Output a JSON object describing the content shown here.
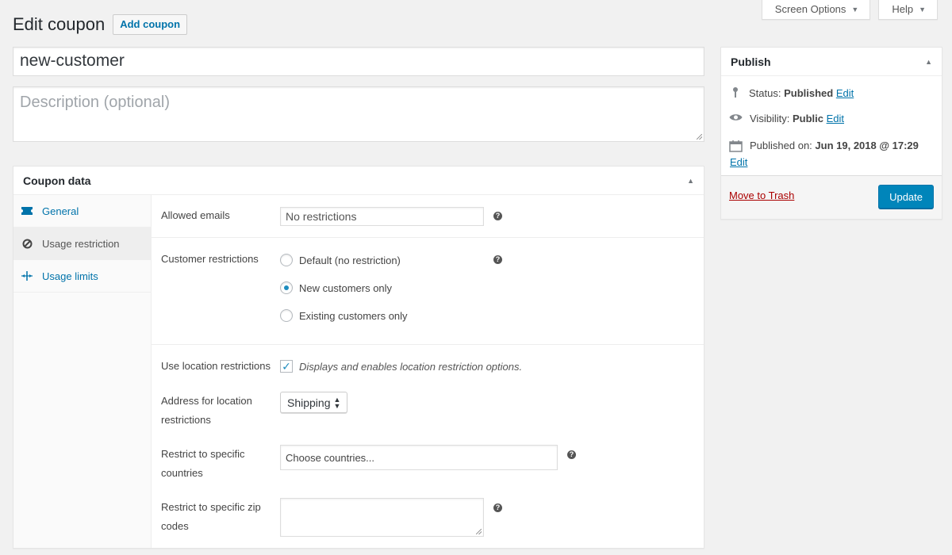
{
  "screen_meta": {
    "screen_options": "Screen Options",
    "help": "Help"
  },
  "page": {
    "title": "Edit coupon",
    "add_button": "Add coupon"
  },
  "coupon": {
    "code": "new-customer",
    "description_placeholder": "Description (optional)"
  },
  "coupon_data": {
    "title": "Coupon data",
    "tabs": [
      {
        "label": "General",
        "icon": "ticket-icon"
      },
      {
        "label": "Usage restriction",
        "icon": "block-icon"
      },
      {
        "label": "Usage limits",
        "icon": "arrows-icon"
      }
    ],
    "allowed_emails": {
      "label": "Allowed emails",
      "value": "No restrictions"
    },
    "customer_restrictions": {
      "label": "Customer restrictions",
      "options": [
        "Default (no restriction)",
        "New customers only",
        "Existing customers only"
      ],
      "selected": "New customers only"
    },
    "use_location": {
      "label": "Use location restrictions",
      "description": "Displays and enables location restriction options.",
      "checked": true
    },
    "address_location": {
      "label_line1": "Address for location",
      "label_line2": "restrictions",
      "value": "Shipping"
    },
    "specific_countries": {
      "label_line1": "Restrict to specific",
      "label_line2": "countries",
      "placeholder": "Choose countries..."
    },
    "zip_codes": {
      "label_line1": "Restrict to specific zip",
      "label_line2": "codes"
    }
  },
  "publish": {
    "title": "Publish",
    "status_label": "Status:",
    "status_value": "Published",
    "visibility_label": "Visibility:",
    "visibility_value": "Public",
    "published_on_label": "Published on:",
    "published_on_value": "Jun 19, 2018 @ 17:29",
    "edit": "Edit",
    "trash": "Move to Trash",
    "update": "Update"
  },
  "colors": {
    "accent": "#0073aa",
    "button": "#0085ba",
    "danger": "#a00"
  }
}
